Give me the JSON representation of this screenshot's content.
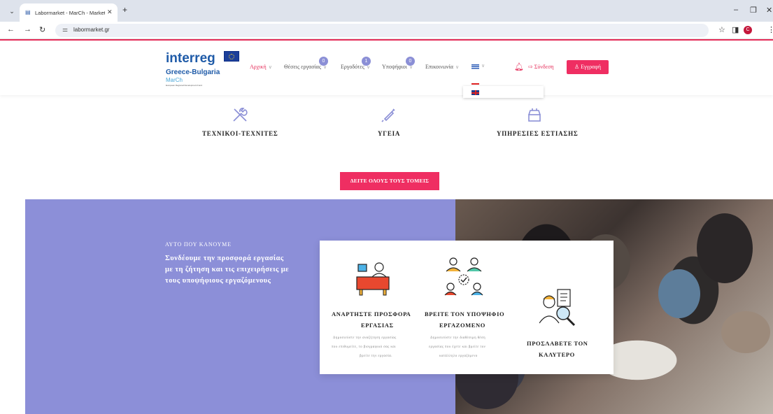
{
  "browser": {
    "tab_title": "Labormarket - MarCh - Market",
    "tab_close": "✕",
    "new_tab": "+",
    "url": "labormarket.gr",
    "profile_initial": "C"
  },
  "header": {
    "logo": {
      "line1": "interreg",
      "line2": "Greece-Bulgaria",
      "line3": "MarCh",
      "line4": "European Regional Development Fund"
    },
    "nav": [
      {
        "label": "Αρχική",
        "active": true
      },
      {
        "label": "Θέσεις εργασίας",
        "badge": "0"
      },
      {
        "label": "Εργοδότες",
        "badge": "1"
      },
      {
        "label": "Υποψήφιοι",
        "badge": "0"
      },
      {
        "label": "Επικοινωνία"
      }
    ],
    "login": "Σύνδεση",
    "register": "Εγγραφή"
  },
  "sectors": [
    {
      "label": "ΤΕΧΝΙΚΟΙ-ΤΕΧΝΙΤΕΣ",
      "icon": "tools-icon"
    },
    {
      "label": "ΥΓΕΙΑ",
      "icon": "syringe-icon"
    },
    {
      "label": "ΥΠΗΡΕΣΙΕΣ ΕΣΤΙΑΣΗΣ",
      "icon": "restaurant-icon"
    }
  ],
  "all_sectors_button": "ΔΕΙΤΕ ΟΛΟΥΣ ΤΟΥΣ ΤΟΜΕΙΣ",
  "what_we_do": {
    "title": "ΑΥΤΟ ΠΟΥ ΚΑΝΟΥΜΕ",
    "lines": [
      "Συνδέουμε την προσφορά εργασίας",
      "με τη ζήτηση και τις επιχειρήσεις με",
      "τους υποψήφιους εργαζόμενους"
    ]
  },
  "features": [
    {
      "title_lines": [
        "ΑΝΑΡΤΗΣΤΕ ΠΡΟΣΦΟΡΑ",
        "ΕΡΓΑΣΙΑΣ"
      ],
      "desc_lines": [
        "Δημοσιεύστε την αναζήτηση εργασίας",
        "που επιθυμείτε, το βιογραφικό σας και",
        "βρείτε την εργασία."
      ]
    },
    {
      "title_lines": [
        "ΒΡΕΙΤΕ ΤΟΝ ΥΠΟΨΗΦΙΟ",
        "ΕΡΓΑΖΟΜΕΝΟ"
      ],
      "desc_lines": [
        "Δημοσιεύστε την διαθέσιμη θέση",
        "εργασίας που έχετε και βρείτε τον",
        "κατάλληλο εργαζόμενο"
      ]
    },
    {
      "title_lines": [
        "ΠΡΟΣΛΑΒΕΤΕ ΤΟΝ",
        "ΚΑΛΥΤΕΡΟ"
      ],
      "desc_lines": []
    }
  ],
  "colors": {
    "accent": "#ef2e62",
    "purple": "#8c8fd8",
    "brand_blue": "#1f5ba8"
  }
}
